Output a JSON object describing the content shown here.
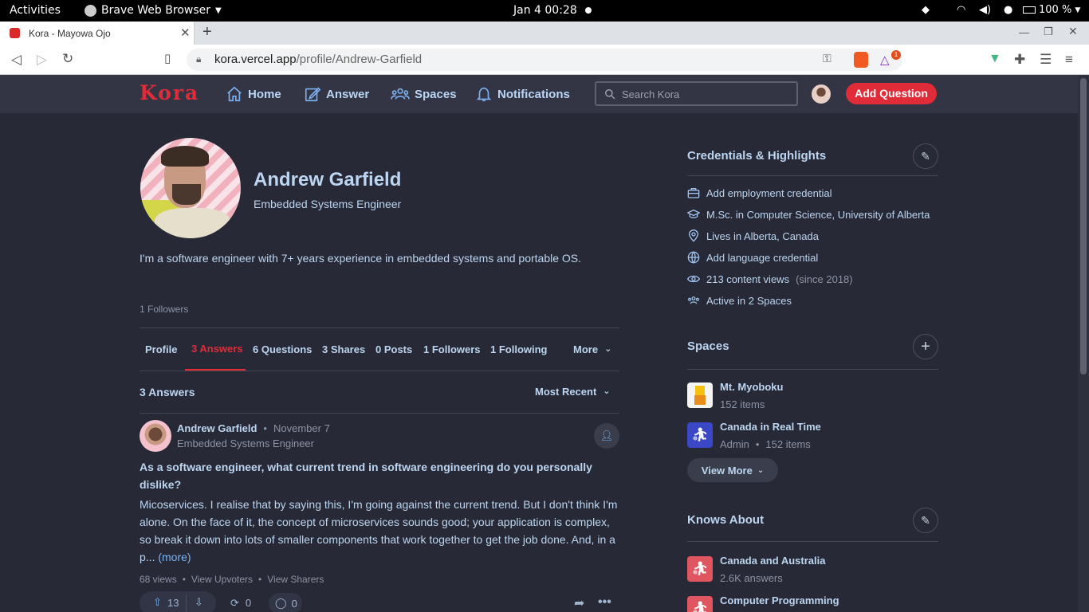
{
  "gnome": {
    "activities": "Activities",
    "app_name": "Brave Web Browser",
    "clock": "Jan 4  00:28",
    "battery": "100 %"
  },
  "browser": {
    "tab_title": "Kora - Mayowa Ojo",
    "url_host": "kora.vercel.app",
    "url_path": "/profile/Andrew-Garfield",
    "brave_badge": "1"
  },
  "header": {
    "logo": "Kora",
    "nav": {
      "home": "Home",
      "answer": "Answer",
      "spaces": "Spaces",
      "notifications": "Notifications"
    },
    "search_placeholder": "Search Kora",
    "add_question": "Add Question"
  },
  "profile": {
    "name": "Andrew Garfield",
    "title": "Embedded Systems Engineer",
    "bio": "I'm a software engineer with 7+ years experience in embedded systems and portable OS.",
    "followers_line": "1 Followers"
  },
  "tabs": {
    "profile": "Profile",
    "answers": "3 Answers",
    "questions": "6 Questions",
    "shares": "3 Shares",
    "posts": "0 Posts",
    "followers": "1 Followers",
    "following": "1 Following",
    "more": "More"
  },
  "answers_section": {
    "heading": "3 Answers",
    "sort": "Most Recent"
  },
  "answer": {
    "author": "Andrew Garfield",
    "date": "November 7",
    "author_title": "Embedded Systems Engineer",
    "question": "As a software engineer, what current trend in software engineering do you personally dislike?",
    "excerpt": "Micoservices. I realise that by saying this, I'm going against the current trend. But I don't think I'm alone. On the face of it, the concept of microservices sounds good; your application is complex, so break it down into lots of smaller components that work together to get the job done. And, in a p...",
    "more": "(more)",
    "views": "68 views",
    "view_upvoters": "View Upvoters",
    "view_sharers": "View Sharers",
    "upvotes": "13",
    "shares": "0",
    "comments": "0"
  },
  "credentials": {
    "heading": "Credentials & Highlights",
    "items": [
      {
        "icon": "briefcase-icon",
        "text": "Add employment credential",
        "extra": ""
      },
      {
        "icon": "graduation-cap-icon",
        "text": "M.Sc. in Computer Science, University of Alberta",
        "extra": ""
      },
      {
        "icon": "location-pin-icon",
        "text": "Lives in Alberta, Canada",
        "extra": ""
      },
      {
        "icon": "globe-icon",
        "text": "Add language credential",
        "extra": ""
      },
      {
        "icon": "eye-icon",
        "text": "213 content views",
        "extra": "(since 2018)"
      },
      {
        "icon": "users-icon",
        "text": "Active in 2 Spaces",
        "extra": ""
      }
    ]
  },
  "spaces": {
    "heading": "Spaces",
    "items": [
      {
        "name": "Mt. Myoboku",
        "role": "",
        "count": "152 items"
      },
      {
        "name": "Canada in Real Time",
        "role": "Admin",
        "count": "152 items"
      }
    ],
    "view_more": "View More"
  },
  "knows_about": {
    "heading": "Knows About",
    "items": [
      {
        "name": "Canada and Australia",
        "count": "2.6K answers"
      },
      {
        "name": "Computer Programming",
        "count": ""
      }
    ]
  },
  "colors": {
    "page_bg": "#272936",
    "header_bg": "#333545",
    "accent_red": "#e02c38",
    "link_blue": "#7db3f0"
  }
}
